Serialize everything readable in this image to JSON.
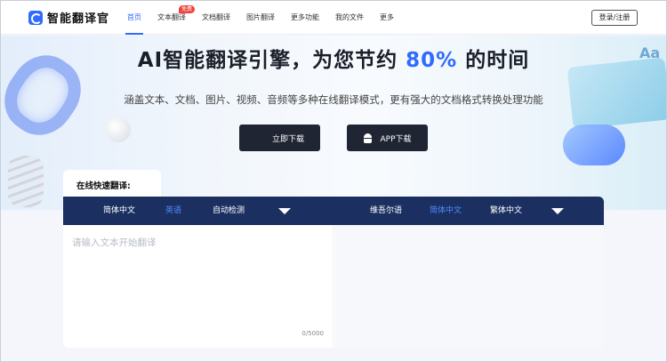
{
  "app": {
    "name": "智能翻译官"
  },
  "nav": {
    "items": [
      {
        "label": "首页",
        "active": true
      },
      {
        "label": "文本翻译",
        "badge": "免费"
      },
      {
        "label": "文档翻译"
      },
      {
        "label": "图片翻译"
      },
      {
        "label": "更多功能"
      },
      {
        "label": "我的文件"
      },
      {
        "label": "更多"
      }
    ],
    "login_label": "登录/注册"
  },
  "hero": {
    "title_pre": "AI智能翻译引擎，为您节约",
    "title_highlight": "80%",
    "title_post": "的时间",
    "subtitle": "涵盖文本、文档、图片、视频、音频等多种在线翻译模式，更有强大的文档格式转换处理功能",
    "download_label": "立即下载",
    "app_download_label": "APP下载"
  },
  "translator": {
    "tab_label": "在线快速翻译:",
    "source_langs": [
      "简体中文",
      "英语",
      "自动检测"
    ],
    "source_active": 1,
    "target_langs": [
      "维吾尔语",
      "简体中文",
      "繁体中文"
    ],
    "target_active": 1,
    "placeholder": "请输入文本开始翻译",
    "counter": "0/5000"
  },
  "colors": {
    "accent": "#2f6bff",
    "lang_bar": "#1b3061",
    "dark_button": "#1f2533",
    "badge": "#f0433a"
  }
}
